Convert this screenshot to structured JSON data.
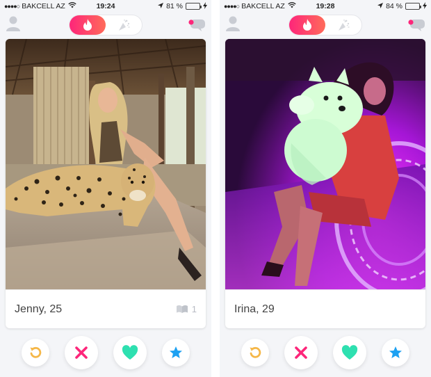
{
  "screens": [
    {
      "status": {
        "signal_dots": "●●●●○",
        "carrier": "BAKCELL AZ",
        "time": "19:24",
        "battery_percent_label": "81 %",
        "battery_level": 0.81
      },
      "nav": {
        "active_tab": "discover"
      },
      "card": {
        "name_age": "Jenny, 25",
        "shared_count": "1"
      },
      "actions": [
        "rewind",
        "nope",
        "like",
        "super-like"
      ]
    },
    {
      "status": {
        "signal_dots": "●●●●○",
        "carrier": "BAKCELL AZ",
        "time": "19:28",
        "battery_percent_label": "84 %",
        "battery_level": 0.84
      },
      "nav": {
        "active_tab": "discover"
      },
      "card": {
        "name_age": "Irina, 29"
      },
      "actions": [
        "rewind",
        "nope",
        "like",
        "super-like"
      ]
    }
  ],
  "colors": {
    "brand_gradient_start": "#fd267a",
    "brand_gradient_end": "#ff6b5a",
    "rewind": "#f5b748",
    "nope": "#fd267a",
    "like": "#2ee0b0",
    "super_like": "#1da1f2"
  },
  "icons": {
    "profile": "person-icon",
    "discover": "flame-icon",
    "feed": "sparkle-icon",
    "messages": "chat-bubbles-icon",
    "shared": "book-icon"
  }
}
